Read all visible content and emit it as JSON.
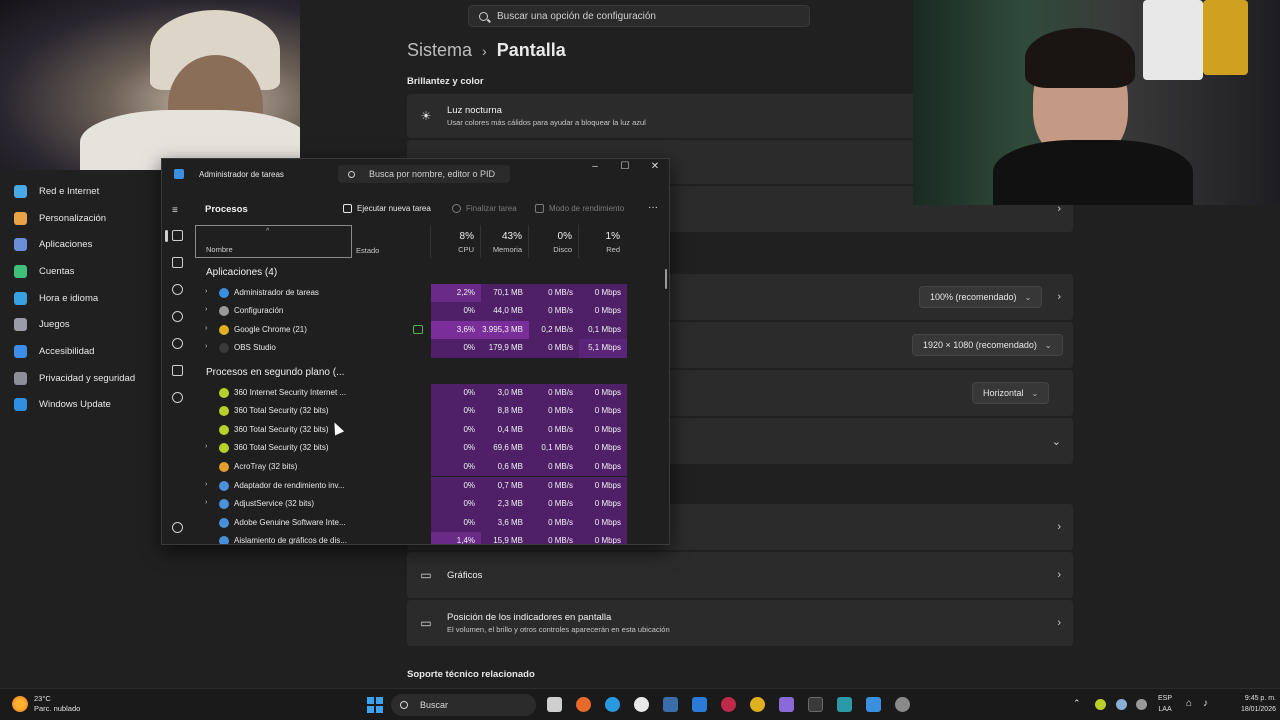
{
  "settings": {
    "search_placeholder": "Buscar una opción de configuración",
    "breadcrumb_parent": "Sistema",
    "breadcrumb_current": "Pantalla",
    "section_brightness": "Brillantez y color",
    "night_light_title": "Luz nocturna",
    "night_light_desc": "Usar colores más cálidos para ayudar a bloquear la luz azul",
    "scale_value": "100% (recomendado)",
    "resolution_value": "1920 × 1080 (recomendado)",
    "orientation_value": "Horizontal",
    "graphics_label": "Gráficos",
    "indicators_title": "Posición de los indicadores en pantalla",
    "indicators_desc": "El volumen, el brillo y otros controles aparecerán en esta ubicación",
    "support_title": "Soporte técnico relacionado"
  },
  "nav": {
    "items": [
      {
        "label": "Red e Internet",
        "color": "#4aa8e8"
      },
      {
        "label": "Personalización",
        "color": "#e8a24a"
      },
      {
        "label": "Aplicaciones",
        "color": "#6a8fd8"
      },
      {
        "label": "Cuentas",
        "color": "#3fbf7a"
      },
      {
        "label": "Hora e idioma",
        "color": "#3aa0e0"
      },
      {
        "label": "Juegos",
        "color": "#9a9aa8"
      },
      {
        "label": "Accesibilidad",
        "color": "#3c8ee8"
      },
      {
        "label": "Privacidad y seguridad",
        "color": "#8e8e98"
      },
      {
        "label": "Windows Update",
        "color": "#2f8fe0"
      }
    ]
  },
  "taskmanager": {
    "title": "Administrador de tareas",
    "search_placeholder": "Busca por nombre, editor o PID",
    "page_title": "Procesos",
    "run_task": "Ejecutar nueva tarea",
    "end_task": "Finalizar tarea",
    "efficiency_mode": "Modo de rendimiento",
    "more": "···",
    "col_name": "Nombre",
    "col_state": "Estado",
    "cpu_pct": "8%",
    "cpu_label": "CPU",
    "mem_pct": "43%",
    "mem_label": "Memoria",
    "disk_pct": "0%",
    "disk_label": "Disco",
    "net_pct": "1%",
    "net_label": "Red",
    "group_apps": "Aplicaciones (4)",
    "group_bg": "Procesos en segundo plano (...",
    "apps": [
      {
        "name": "Administrador de tareas",
        "cpu": "2,2%",
        "mem": "70,1 MB",
        "disk": "0 MB/s",
        "net": "0 Mbps",
        "icon_color": "#3b8fe0"
      },
      {
        "name": "Configuración",
        "cpu": "0%",
        "mem": "44,0 MB",
        "disk": "0 MB/s",
        "net": "0 Mbps",
        "icon_color": "#9a9a9a"
      },
      {
        "name": "Google Chrome (21)",
        "cpu": "3,6%",
        "mem": "3.995,3 MB",
        "disk": "0,2 MB/s",
        "net": "0,1 Mbps",
        "icon_color": "#e0b020"
      },
      {
        "name": "OBS Studio",
        "cpu": "0%",
        "mem": "179,9 MB",
        "disk": "0 MB/s",
        "net": "5,1 Mbps",
        "icon_color": "#3a3a3a"
      }
    ],
    "background": [
      {
        "name": "360 Internet Security Internet ...",
        "cpu": "0%",
        "mem": "3,0 MB",
        "disk": "0 MB/s",
        "net": "0 Mbps",
        "icon_color": "#b8d02a"
      },
      {
        "name": "360 Total Security (32 bits)",
        "cpu": "0%",
        "mem": "8,8 MB",
        "disk": "0 MB/s",
        "net": "0 Mbps",
        "icon_color": "#b8d02a"
      },
      {
        "name": "360 Total Security (32 bits)",
        "cpu": "0%",
        "mem": "0,4 MB",
        "disk": "0 MB/s",
        "net": "0 Mbps",
        "icon_color": "#b8d02a"
      },
      {
        "name": "360 Total Security (32 bits)",
        "cpu": "0%",
        "mem": "69,6 MB",
        "disk": "0,1 MB/s",
        "net": "0 Mbps",
        "icon_color": "#b8d02a"
      },
      {
        "name": "AcroTray (32 bits)",
        "cpu": "0%",
        "mem": "0,6 MB",
        "disk": "0 MB/s",
        "net": "0 Mbps",
        "icon_color": "#e0a030"
      },
      {
        "name": "Adaptador de rendimiento inv...",
        "cpu": "0%",
        "mem": "0,7 MB",
        "disk": "0 MB/s",
        "net": "0 Mbps",
        "icon_color": "#4a90d8"
      },
      {
        "name": "AdjustService (32 bits)",
        "cpu": "0%",
        "mem": "2,3 MB",
        "disk": "0 MB/s",
        "net": "0 Mbps",
        "icon_color": "#4a90d8"
      },
      {
        "name": "Adobe Genuine Software Inte...",
        "cpu": "0%",
        "mem": "3,6 MB",
        "disk": "0 MB/s",
        "net": "0 Mbps",
        "icon_color": "#4a90d8"
      },
      {
        "name": "Aislamiento de gráficos de dis...",
        "cpu": "1,4%",
        "mem": "15,9 MB",
        "disk": "0 MB/s",
        "net": "0 Mbps",
        "icon_color": "#4a90d8"
      }
    ]
  },
  "taskbar": {
    "temp": "23°C",
    "weather": "Parc. nublado",
    "search_label": "Buscar",
    "lang1": "ESP",
    "lang2": "LAA",
    "time": "9:45 p. m.",
    "date": "18/01/2026"
  }
}
